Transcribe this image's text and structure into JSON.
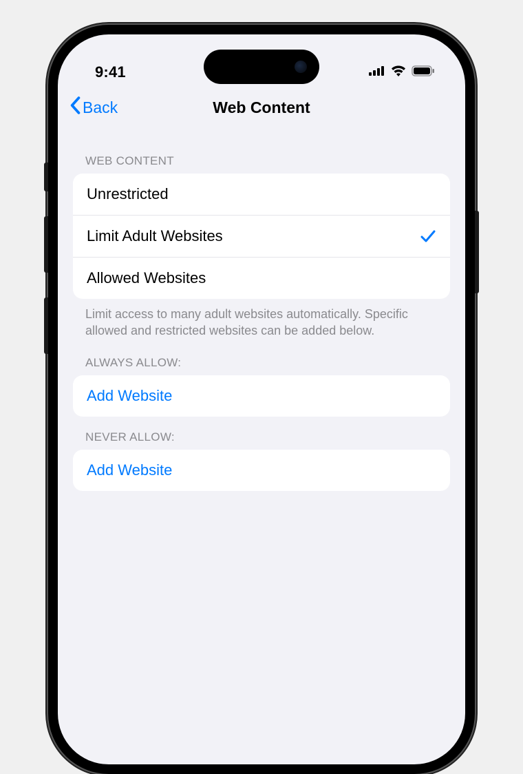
{
  "statusBar": {
    "time": "9:41"
  },
  "nav": {
    "backLabel": "Back",
    "title": "Web Content"
  },
  "sections": {
    "webContent": {
      "header": "WEB CONTENT",
      "options": [
        {
          "label": "Unrestricted",
          "selected": false
        },
        {
          "label": "Limit Adult Websites",
          "selected": true
        },
        {
          "label": "Allowed Websites",
          "selected": false
        }
      ],
      "footer": "Limit access to many adult websites automatically. Specific allowed and restricted websites can be added below."
    },
    "alwaysAllow": {
      "header": "ALWAYS ALLOW:",
      "addLabel": "Add Website"
    },
    "neverAllow": {
      "header": "NEVER ALLOW:",
      "addLabel": "Add Website"
    }
  },
  "colors": {
    "accent": "#007aff",
    "background": "#f2f2f7"
  }
}
